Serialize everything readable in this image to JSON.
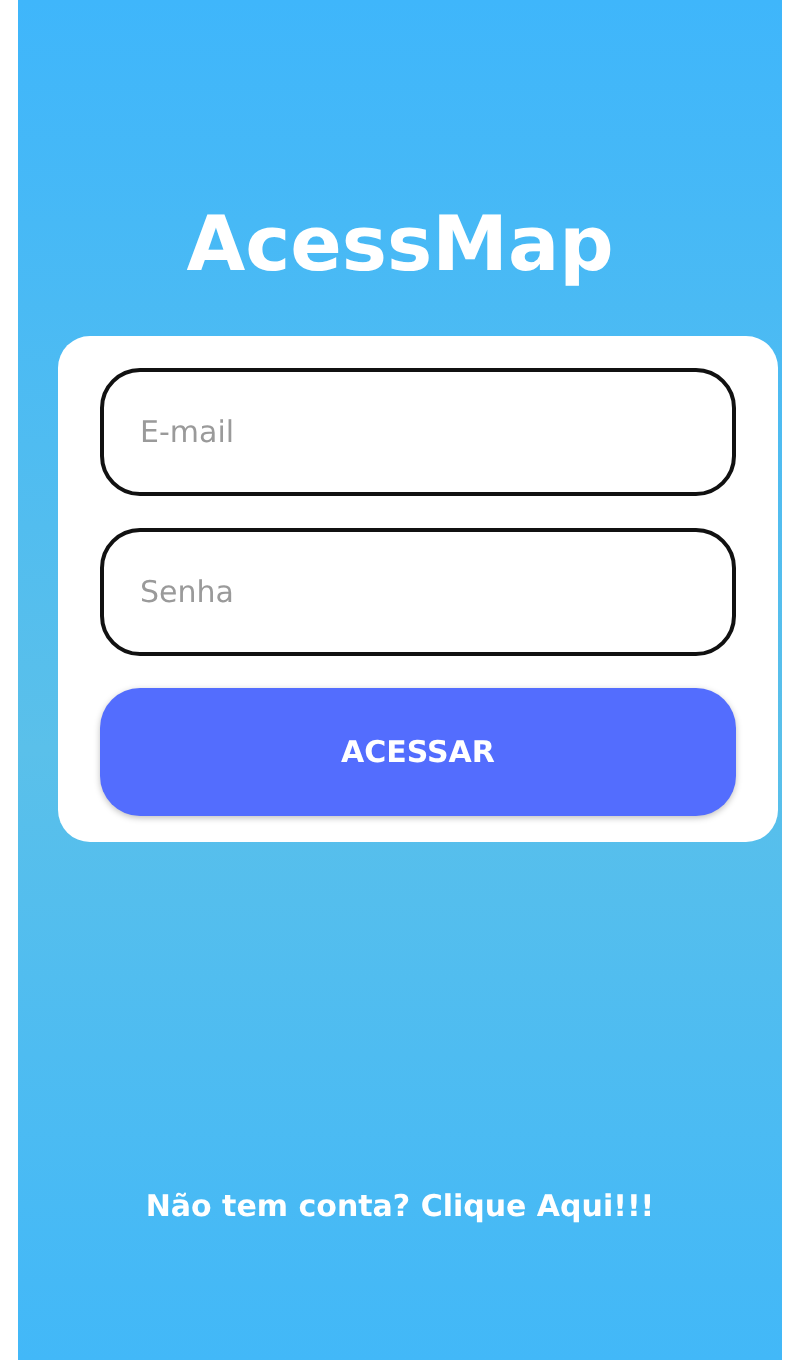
{
  "title": "AcessMap",
  "fields": [
    {
      "placeholder": "E-mail"
    },
    {
      "placeholder": "Senha"
    }
  ],
  "button": "ACESSAR",
  "signup_link": "Não tem conta? Clique Aqui!!!"
}
